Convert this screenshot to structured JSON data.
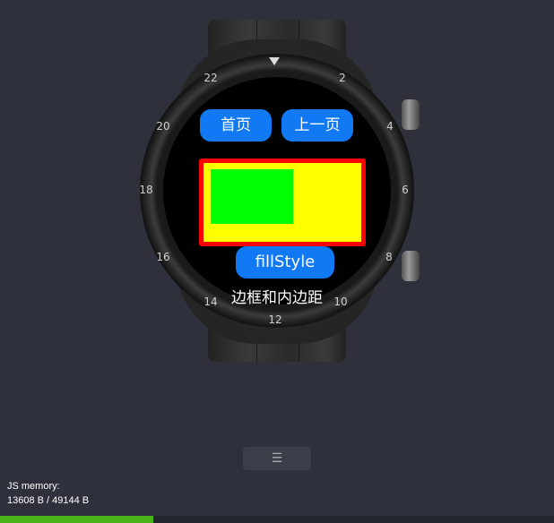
{
  "watch": {
    "bezel_numbers": [
      {
        "text": "2"
      },
      {
        "text": "4"
      },
      {
        "text": "6"
      },
      {
        "text": "8"
      },
      {
        "text": "10"
      },
      {
        "text": "12"
      },
      {
        "text": "14"
      },
      {
        "text": "16"
      },
      {
        "text": "18"
      },
      {
        "text": "20"
      },
      {
        "text": "22"
      }
    ]
  },
  "screen": {
    "home_button": "首页",
    "prev_button": "上一页",
    "fill_button": "fillStyle",
    "caption": "边框和内边距",
    "colors": {
      "border": "#ff0000",
      "fill": "#ffff00",
      "inner": "#00ff00",
      "button": "#1179f3"
    }
  },
  "toolbar": {
    "menu_icon": "menu-icon"
  },
  "memory": {
    "label": "JS memory:",
    "value": "13608 B / 49144 B",
    "fraction": 0.277
  }
}
